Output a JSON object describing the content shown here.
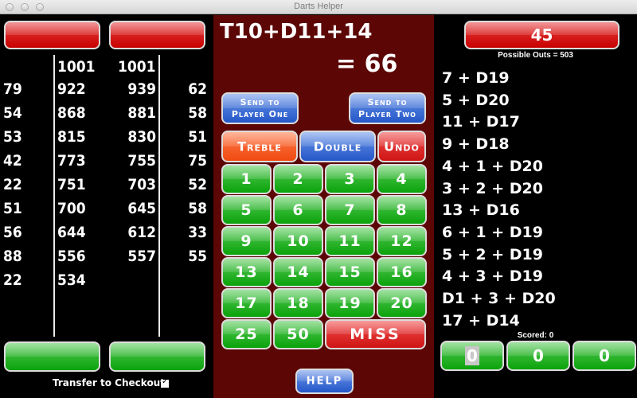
{
  "window": {
    "title": "Darts Helper"
  },
  "left": {
    "player_one_name": "",
    "player_two_name": "",
    "starting_scores": [
      "1001",
      "1001"
    ],
    "player_one_throws": [
      "79",
      "54",
      "53",
      "42",
      "22",
      "51",
      "56",
      "88",
      "22"
    ],
    "player_one_remaining": [
      "922",
      "868",
      "815",
      "773",
      "751",
      "700",
      "644",
      "556",
      "534"
    ],
    "player_two_remaining": [
      "939",
      "881",
      "830",
      "755",
      "703",
      "645",
      "612",
      "557"
    ],
    "player_two_throws": [
      "62",
      "58",
      "51",
      "75",
      "52",
      "58",
      "33",
      "55"
    ],
    "bottom_left_button": "",
    "bottom_right_button": "",
    "transfer_label": "Transfer to Checkout",
    "transfer_checked": true
  },
  "middle": {
    "expression": "T10+D11+14",
    "result": "= 66",
    "send_p1": [
      "Send to",
      "Player One"
    ],
    "send_p2": [
      "Send to",
      "Player Two"
    ],
    "treble": "Treble",
    "double": "Double",
    "undo": "Undo",
    "numbers": [
      "1",
      "2",
      "3",
      "4",
      "5",
      "6",
      "7",
      "8",
      "9",
      "10",
      "11",
      "12",
      "13",
      "14",
      "15",
      "16",
      "17",
      "18",
      "19",
      "20"
    ],
    "bull_25": "25",
    "bull_50": "50",
    "miss": "MISS",
    "help": "HELP"
  },
  "right": {
    "remaining": "45",
    "possible_outs": "Possible Outs = 503",
    "outs": [
      "7 + D19",
      "5 + D20",
      "11 + D17",
      "9 + D18",
      "4 + 1 + D20",
      "3 + 2 + D20",
      "13 + D16",
      "6 + 1 + D19",
      "5 + 2 + D19",
      "4 + 3 + D19",
      "D1 + 3 + D20",
      "17 + D14"
    ],
    "scored": "Scored: 0",
    "darts": [
      "0",
      "0",
      "0"
    ]
  },
  "colors": {
    "middle_bg": "#5c0606",
    "green": "#0aa30a",
    "red": "#c80000",
    "blue": "#2457c8",
    "orange": "#f04a10"
  }
}
